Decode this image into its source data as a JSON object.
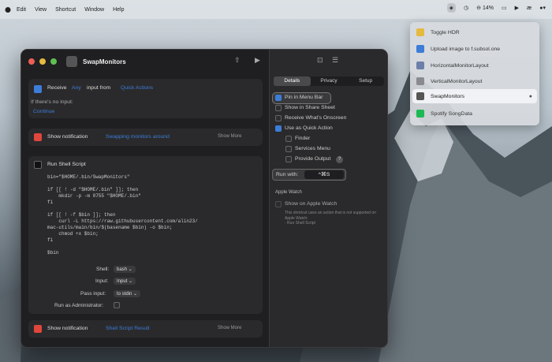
{
  "menubar": {
    "items": [
      "Edit",
      "View",
      "Shortcut",
      "Window",
      "Help"
    ],
    "battery": "14%"
  },
  "window": {
    "title": "SwapMonitors"
  },
  "actions": {
    "receive": {
      "label": "Receive",
      "any": "Any",
      "input_from": "input from",
      "source": "Quick Actions",
      "if_none": "If there's no input:",
      "continue": "Continue"
    },
    "notify1": {
      "label": "Show notification",
      "value": "Swapping monitors around",
      "more": "Show More"
    },
    "shell": {
      "label": "Run Shell Script",
      "code": "bin=\"$HOME/.bin/SwapMonitors\"\n\nif [[ ! -d \"$HOME/.bin\" ]]; then\n    mkdir -p -m 0755 \"$HOME/.bin\"\nfi\n\nif [[ ! -f $bin ]]; then\n    curl -L https://raw.githubusercontent.com/alin23/\nmac-utils/main/bin/$(basename $bin) -o $bin;\n    chmod +x $bin;\nfi\n\n$bin",
      "shell_label": "Shell:",
      "shell_value": "bash",
      "input_label": "Input:",
      "input_value": "Input",
      "pass_label": "Pass input:",
      "pass_value": "to stdin",
      "admin_label": "Run as Administrator:"
    },
    "notify2": {
      "label": "Show notification",
      "value": "Shell Script Result",
      "more": "Show More"
    }
  },
  "details": {
    "tabs": [
      "Details",
      "Privacy",
      "Setup"
    ],
    "options": [
      {
        "label": "Pin in Menu Bar",
        "checked": true
      },
      {
        "label": "Show in Share Sheet",
        "checked": false
      },
      {
        "label": "Receive What's Onscreen",
        "checked": false
      },
      {
        "label": "Use as Quick Action",
        "checked": true
      },
      {
        "label": "Finder",
        "checked": false
      },
      {
        "label": "Services Menu",
        "checked": false
      },
      {
        "label": "Provide Output",
        "checked": false
      }
    ],
    "run_with_label": "Run with:",
    "run_with_value": "^⌘S",
    "watch_heading": "Apple Watch",
    "watch_label": "Show on Apple Watch",
    "watch_note": "This shortcut uses an action that is not supported on Apple Watch:\n· Run Shell Script"
  },
  "dropdown": {
    "items": [
      "Toggle HDR",
      "Upload image to f.subsol.one",
      "HorizontalMonitorLayout",
      "VerticalMonitorLayout",
      "SwapMonitors",
      "Spotify SongData"
    ]
  },
  "colors": {
    "accent": "#3d7dd8",
    "highlight": "#f0f2f5"
  }
}
